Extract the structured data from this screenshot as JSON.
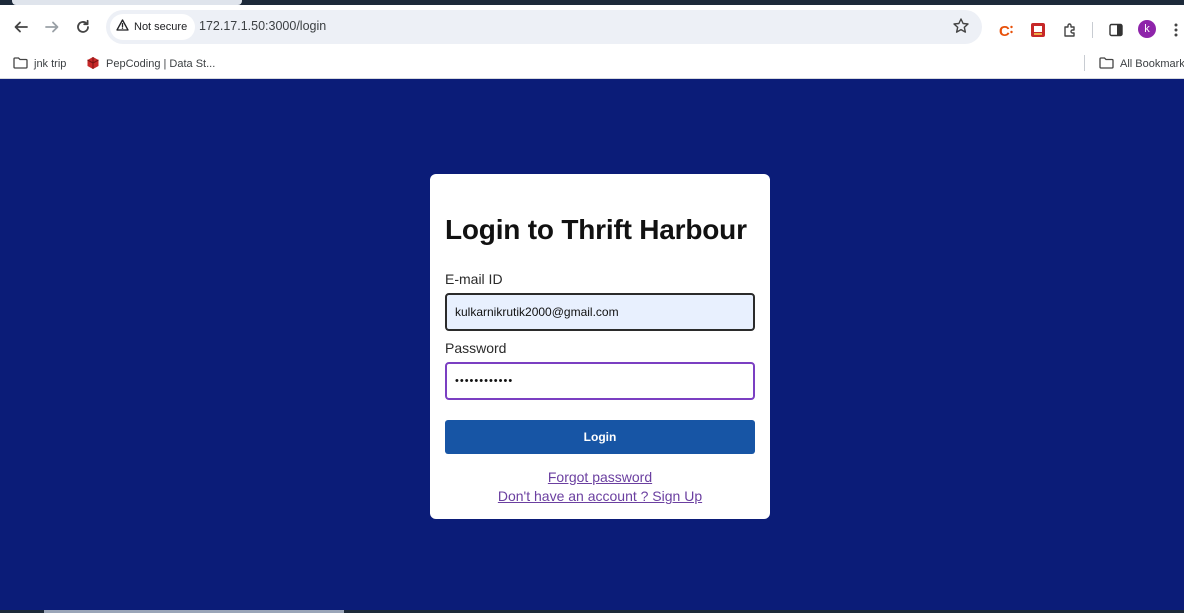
{
  "browser": {
    "security_label": "Not secure",
    "url": "172.17.1.50:3000/login",
    "profile_initial": "k",
    "icons": {
      "back": "back-arrow-icon",
      "forward": "forward-arrow-icon",
      "reload": "reload-icon",
      "warning": "warning-triangle-icon",
      "bookmark_star": "star-icon",
      "extension1": "c-extension-icon",
      "extension2": "red-extension-icon",
      "extensions": "puzzle-icon",
      "side_panel": "side-panel-icon",
      "menu": "kebab-menu-icon",
      "folder": "folder-icon"
    },
    "colors": {
      "avatar": "#8e24aa",
      "extension1": "#e8510a",
      "extension2": "#c62828"
    }
  },
  "bookmarks": {
    "items": [
      {
        "label": "jnk trip",
        "icon": "folder-icon"
      },
      {
        "label": "PepCoding | Data St...",
        "icon": "pepcoding-icon"
      }
    ],
    "all_bookmarks": "All Bookmarks"
  },
  "login": {
    "title": "Login to Thrift Harbour",
    "email_label": "E-mail ID",
    "email_value": "kulkarnikrutik2000@gmail.com",
    "password_label": "Password",
    "password_value": "••••••••••••",
    "login_button": "Login",
    "forgot_link": "Forgot password",
    "signup_link": "Don't have an account ? Sign Up",
    "colors": {
      "page_background": "#0b1c78",
      "button": "#1755a5",
      "link": "#6b3fa0",
      "focus_border": "#7b3fc2"
    }
  }
}
